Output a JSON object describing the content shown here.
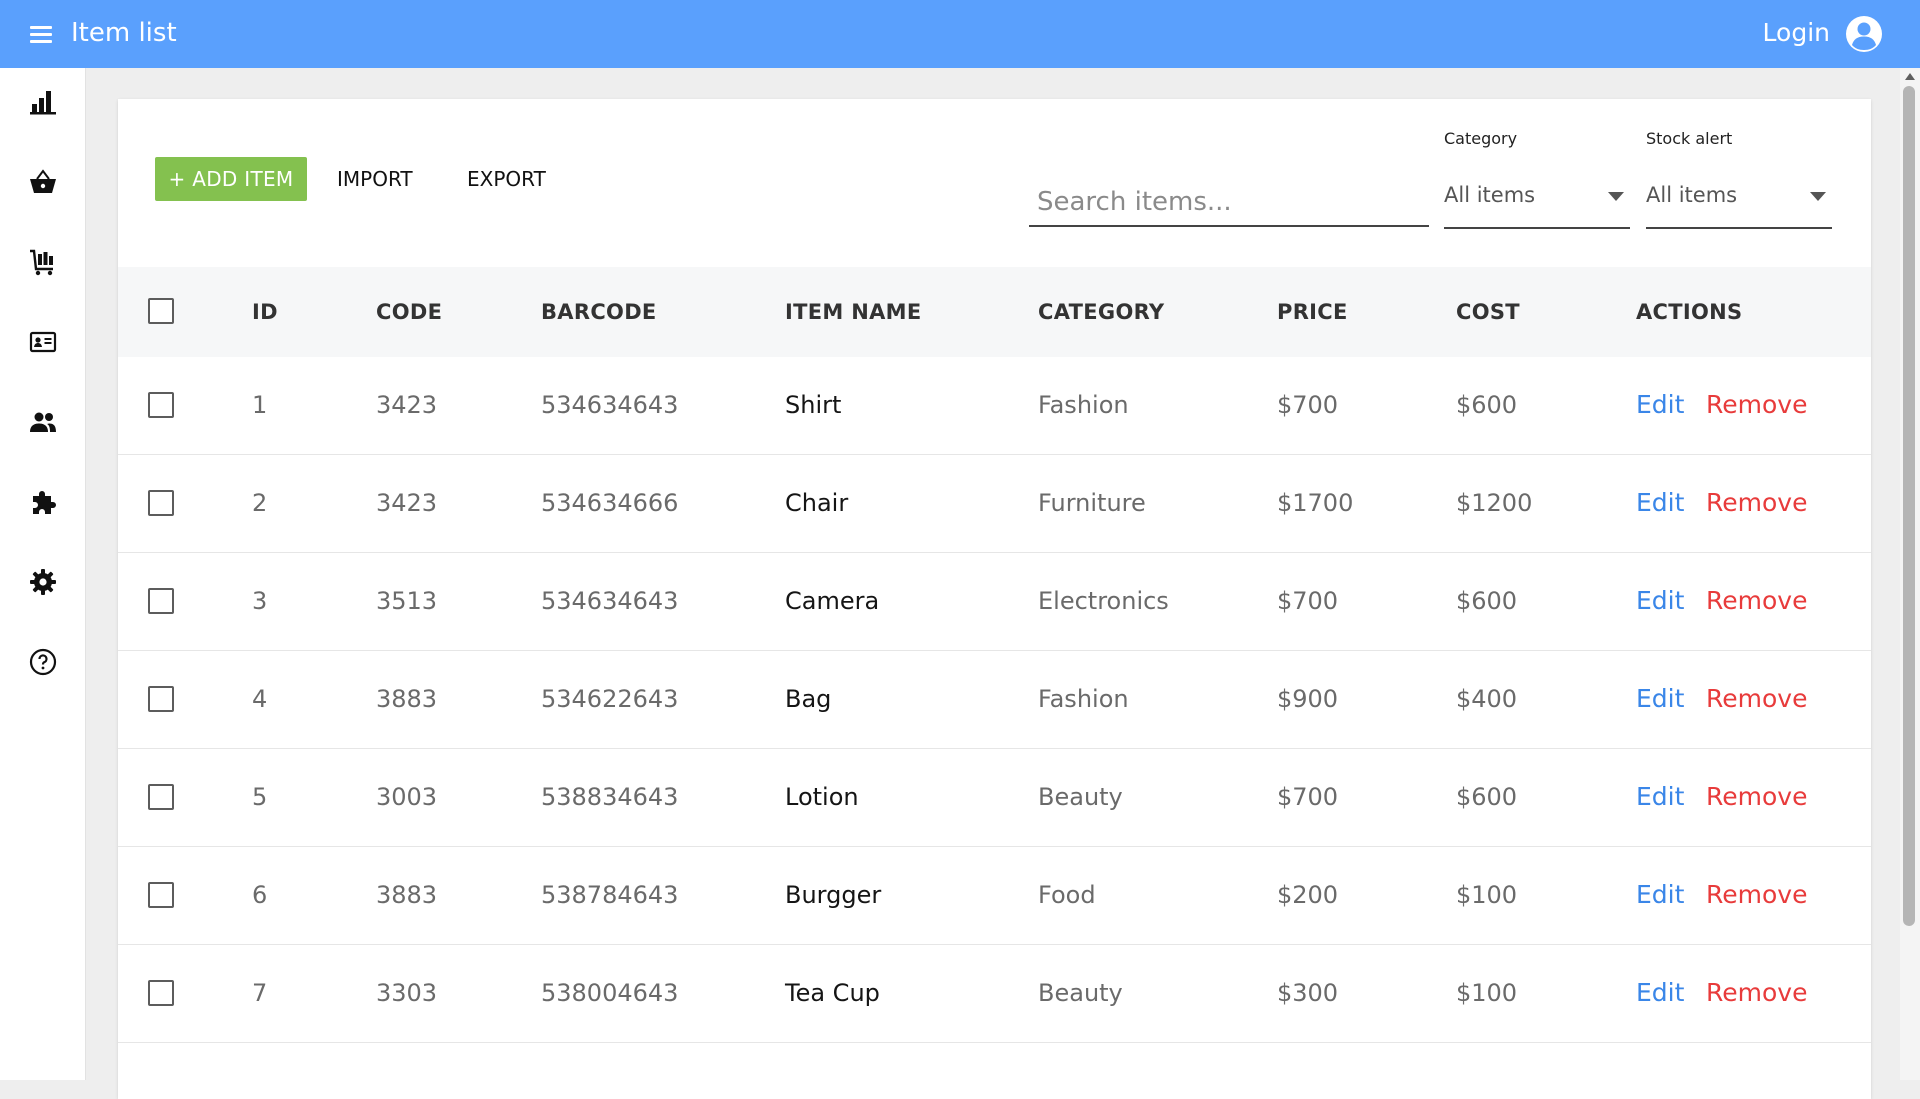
{
  "app_bar": {
    "title": "Item list",
    "login_label": "Login",
    "color": "#5aa0fd"
  },
  "sidebar": {
    "items": [
      {
        "icon": "bar-chart-icon"
      },
      {
        "icon": "basket-icon"
      },
      {
        "icon": "cart-icon"
      },
      {
        "icon": "id-card-icon"
      },
      {
        "icon": "people-icon"
      },
      {
        "icon": "puzzle-icon"
      },
      {
        "icon": "gear-icon"
      },
      {
        "icon": "help-icon"
      }
    ]
  },
  "toolbar": {
    "add_label": "+ ADD ITEM",
    "import_label": "IMPORT",
    "export_label": "EXPORT",
    "add_color": "#84c14f"
  },
  "search": {
    "placeholder": "Search items...",
    "value": ""
  },
  "filters": {
    "category": {
      "label": "Category",
      "value": "All items"
    },
    "stock_alert": {
      "label": "Stock alert",
      "value": "All items"
    }
  },
  "table": {
    "headers": [
      "ID",
      "CODE",
      "BARCODE",
      "ITEM NAME",
      "CATEGORY",
      "PRICE",
      "COST",
      "ACTIONS"
    ],
    "edit_label": "Edit",
    "remove_label": "Remove",
    "edit_color": "#3a86e8",
    "remove_color": "#e83b3b",
    "rows": [
      {
        "id": "1",
        "code": "3423",
        "barcode": "534634643",
        "name": "Shirt",
        "category": "Fashion",
        "price": "$700",
        "cost": "$600"
      },
      {
        "id": "2",
        "code": "3423",
        "barcode": "534634666",
        "name": "Chair",
        "category": "Furniture",
        "price": "$1700",
        "cost": "$1200"
      },
      {
        "id": "3",
        "code": "3513",
        "barcode": "534634643",
        "name": "Camera",
        "category": "Electronics",
        "price": "$700",
        "cost": "$600"
      },
      {
        "id": "4",
        "code": "3883",
        "barcode": "534622643",
        "name": "Bag",
        "category": "Fashion",
        "price": "$900",
        "cost": "$400"
      },
      {
        "id": "5",
        "code": "3003",
        "barcode": "538834643",
        "name": "Lotion",
        "category": "Beauty",
        "price": "$700",
        "cost": "$600"
      },
      {
        "id": "6",
        "code": "3883",
        "barcode": "538784643",
        "name": "Burgger",
        "category": "Food",
        "price": "$200",
        "cost": "$100"
      },
      {
        "id": "7",
        "code": "3303",
        "barcode": "538004643",
        "name": "Tea Cup",
        "category": "Beauty",
        "price": "$300",
        "cost": "$100"
      }
    ]
  }
}
